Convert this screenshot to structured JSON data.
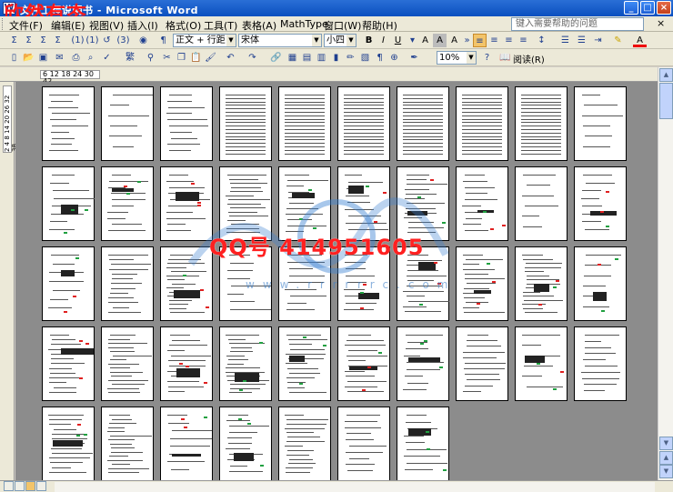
{
  "window": {
    "title": "文件工程说明书 - Microsoft Word",
    "watermark_top": "欣然有态",
    "controls": [
      "minimize",
      "maximize",
      "close"
    ]
  },
  "menubar": {
    "items": [
      "文件(F)",
      "编辑(E)",
      "视图(V)",
      "插入(I)",
      "格式(O)",
      "工具(T)",
      "表格(A)",
      "MathType",
      "窗口(W)",
      "帮助(H)"
    ],
    "help_placeholder": "键入需要帮助的问题"
  },
  "toolbar_format": {
    "style": "正文 + 行距",
    "font": "宋体",
    "size": "小四",
    "bold": "B",
    "italic": "I",
    "underline": "U"
  },
  "toolbar_standard": {
    "zoom": "10%",
    "reading": "阅读(R)"
  },
  "ruler": {
    "horizontal": "6 12 18 24 30 42",
    "vertical": "2 4 8 14 20 26 32 38"
  },
  "overlay": {
    "qq": "QQ号 414951605",
    "url": "www.rrrrrrc.com"
  },
  "colors": {
    "title_bar": "#0a4fbf",
    "chrome": "#ece9d8",
    "canvas": "#8c8c8c",
    "watermark": "#ff2020"
  }
}
